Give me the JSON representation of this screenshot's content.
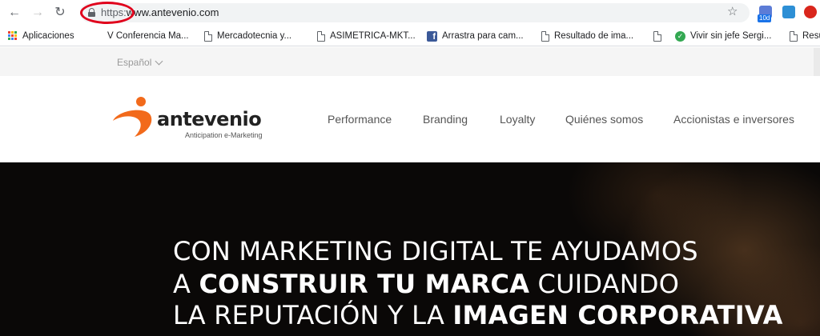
{
  "browser": {
    "url_scheme": "https:",
    "url_host": "www.antevenio.com",
    "extension_badge": "10d",
    "icons": [
      "back-icon",
      "forward-icon",
      "reload-icon",
      "lock-icon",
      "star-icon"
    ]
  },
  "bookmarks": [
    {
      "label": "Aplicaciones",
      "icon": "apps-icon"
    },
    {
      "label": "V Conferencia Ma...",
      "icon": "none"
    },
    {
      "label": "Mercadotecnia y...",
      "icon": "page-icon"
    },
    {
      "label": "ASIMETRICA-MKT...",
      "icon": "page-icon"
    },
    {
      "label": "Arrastra para cam...",
      "icon": "facebook-icon"
    },
    {
      "label": "Resultado de ima...",
      "icon": "page-icon"
    },
    {
      "label": "",
      "icon": "page-icon"
    },
    {
      "label": "Vivir sin jefe Sergi...",
      "icon": "check-icon"
    },
    {
      "label": "Resu",
      "icon": "page-icon"
    }
  ],
  "site": {
    "language": "Español",
    "logo_text": "antevenio",
    "logo_tagline": "Anticipation e-Marketing",
    "menu": [
      "Performance",
      "Branding",
      "Loyalty",
      "Quiénes somos",
      "Accionistas e inversores"
    ],
    "hero": {
      "line1": "CON MARKETING DIGITAL TE AYUDAMOS",
      "line2_pre": "A ",
      "line2_bold": "CONSTRUIR TU MARCA",
      "line2_post": " CUIDANDO",
      "line3_pre": "LA REPUTACIÓN Y LA ",
      "line3_bold": "IMAGEN CORPORATIVA"
    }
  },
  "colors": {
    "logo_orange": "#f26a1b",
    "annotation_red": "#e0001b",
    "hero_background": "#0a0807"
  }
}
